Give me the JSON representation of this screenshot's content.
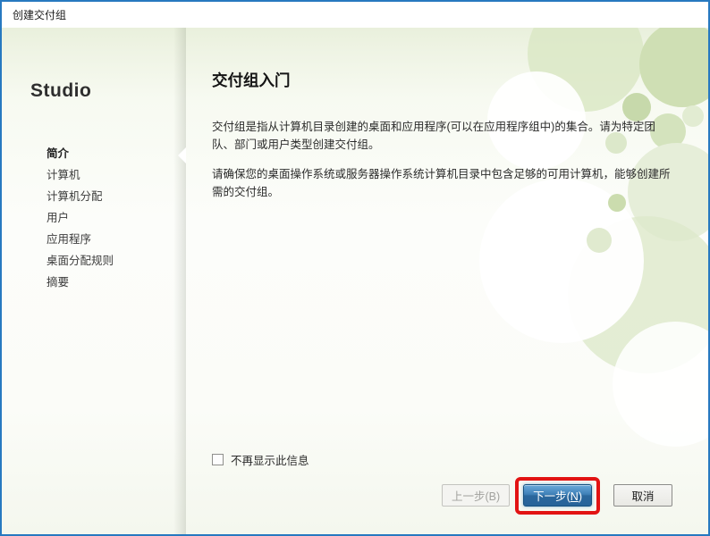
{
  "window": {
    "title": "创建交付组"
  },
  "sidebar": {
    "brand": "Studio",
    "items": [
      {
        "label": "简介"
      },
      {
        "label": "计算机"
      },
      {
        "label": "计算机分配"
      },
      {
        "label": "用户"
      },
      {
        "label": "应用程序"
      },
      {
        "label": "桌面分配规则"
      },
      {
        "label": "摘要"
      }
    ],
    "active_item": "简介"
  },
  "content": {
    "heading": "交付组入门",
    "paragraph1": "交付组是指从计算机目录创建的桌面和应用程序(可以在应用程序组中)的集合。请为特定团队、部门或用户类型创建交付组。",
    "paragraph2": "请确保您的桌面操作系统或服务器操作系统计算机目录中包含足够的可用计算机，能够创建所需的交付组。",
    "checkbox_label": "不再显示此信息",
    "checkbox_checked": false
  },
  "footer": {
    "back_label": "上一步(B)",
    "back_enabled": false,
    "next_label_prefix": "下一步(",
    "next_access_key": "N",
    "next_label_suffix": ")",
    "cancel_label": "取消"
  },
  "colors": {
    "window_border": "#2779c0",
    "primary_button": "#28639a",
    "annotation_highlight": "#e21313",
    "background_green": "#e9f0dc"
  }
}
